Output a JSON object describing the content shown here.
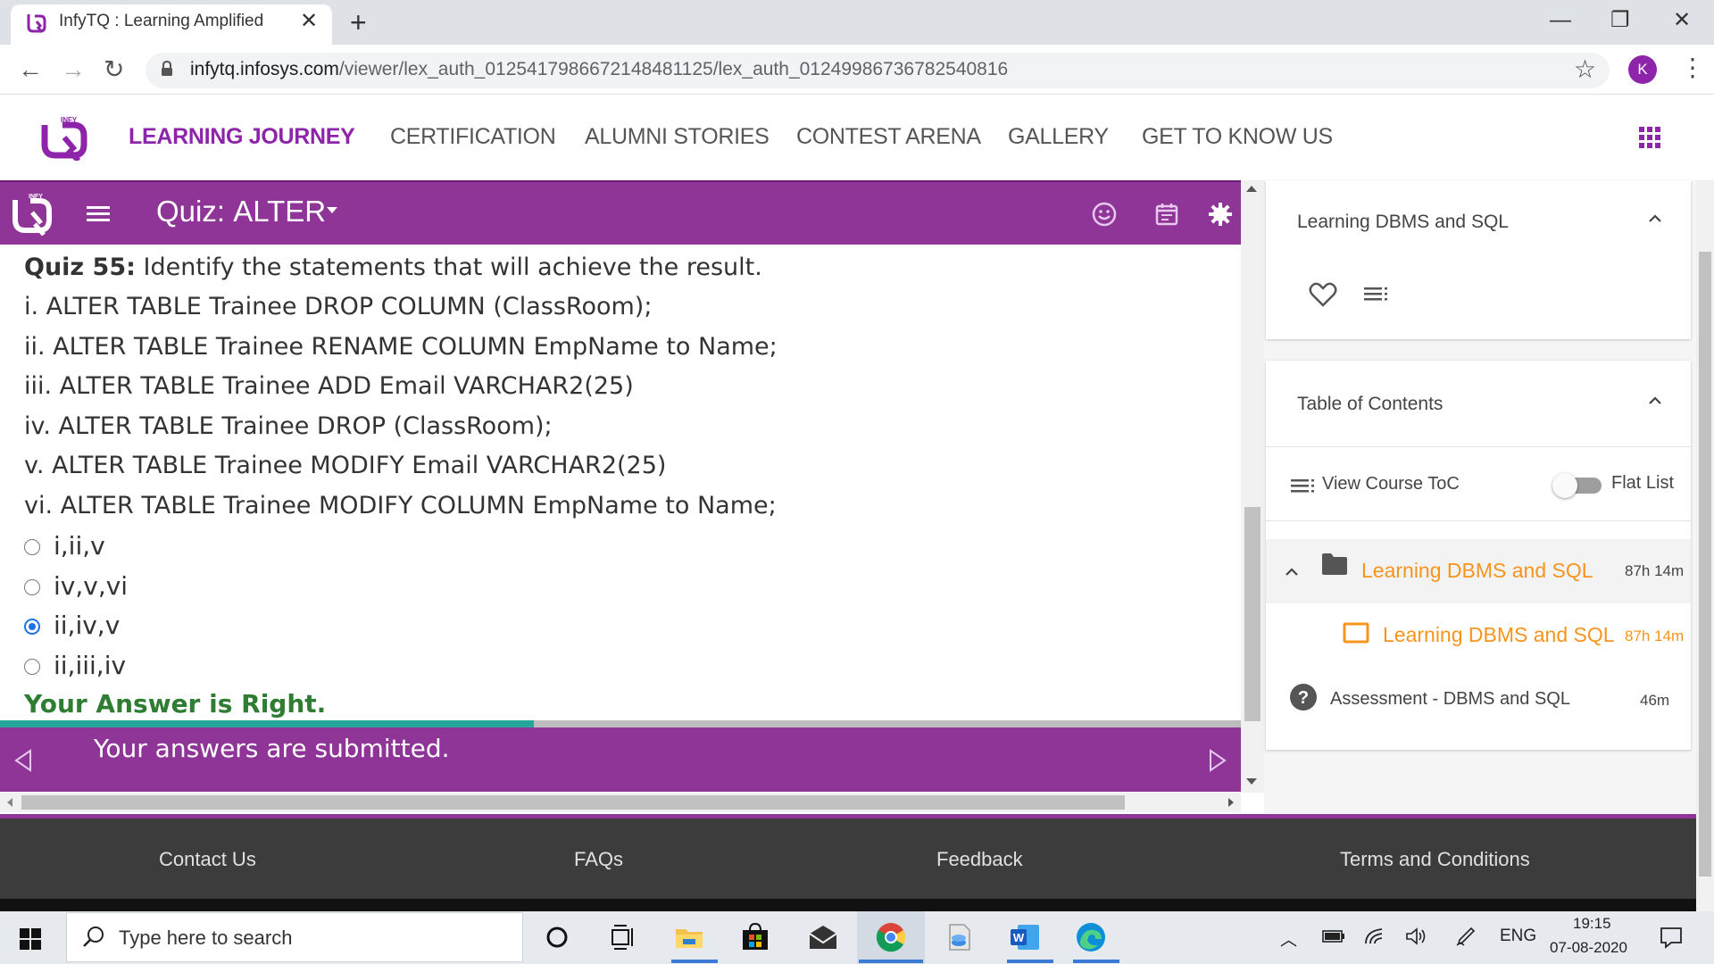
{
  "browser": {
    "tab_title": "InfyTQ : Learning Amplified",
    "tab_close": "✕",
    "new_tab": "+",
    "url_domain": "infytq.infosys.com",
    "url_path": "/viewer/lex_auth_01254179866721484811​25/lex_auth_01249986736782540816",
    "profile_initial": "K",
    "window_controls": [
      "—",
      "❐",
      "✕"
    ]
  },
  "site_nav": {
    "items": [
      "LEARNING JOURNEY",
      "CERTIFICATION",
      "ALUMNI STORIES",
      "CONTEST ARENA",
      "GALLERY",
      "GET TO KNOW US"
    ],
    "active": "LEARNING JOURNEY",
    "accent_color": "#8e24aa"
  },
  "player": {
    "title_prefix": "Quiz:",
    "title": "ALTER",
    "bar_color": "#8e3597",
    "icons": [
      "smiley-icon",
      "calendar-icon",
      "settings-icon"
    ]
  },
  "quiz": {
    "heading_bold": "Quiz 55:",
    "heading_text": " Identify the statements that will achieve the result.",
    "statements": [
      "i. ALTER TABLE Trainee DROP COLUMN (ClassRoom);",
      "ii. ALTER TABLE Trainee RENAME COLUMN EmpName to Name;",
      "iii. ALTER TABLE Trainee ADD Email VARCHAR2(25)",
      "iv. ALTER TABLE Trainee DROP (ClassRoom);",
      "v. ALTER TABLE Trainee MODIFY Email VARCHAR2(25)",
      "vi. ALTER TABLE Trainee MODIFY COLUMN EmpName to Name;"
    ],
    "options": [
      "i,ii,v",
      "iv,v,vi",
      "ii,iv,v",
      "ii,iii,iv"
    ],
    "selected_option": 2,
    "result": "Your Answer is Right.",
    "result_color": "#2e7d32",
    "progress_fraction": 0.43,
    "submitted_text": "Your answers are submitted."
  },
  "right_panel": {
    "card1_title": "Learning DBMS and SQL",
    "card2_title": "Table of Contents",
    "view_toc": "View Course ToC",
    "flat_list": "Flat List",
    "flat_list_on": false,
    "toc": [
      {
        "title": "Learning DBMS and SQL",
        "duration": "87h 14m",
        "icon": "folder-icon"
      },
      {
        "title": "Learning DBMS and SQL",
        "duration": "87h 14m",
        "icon": "tv-icon"
      },
      {
        "title": "Assessment - DBMS and SQL",
        "duration": "46m",
        "icon": "help-icon"
      }
    ],
    "toc_highlight_color": "#f7941d"
  },
  "footer": {
    "links": [
      "Contact Us",
      "FAQs",
      "Feedback",
      "Terms and Conditions"
    ]
  },
  "taskbar": {
    "search_placeholder": "Type here to search",
    "language": "ENG",
    "time": "19:15",
    "date": "07-08-2020"
  }
}
